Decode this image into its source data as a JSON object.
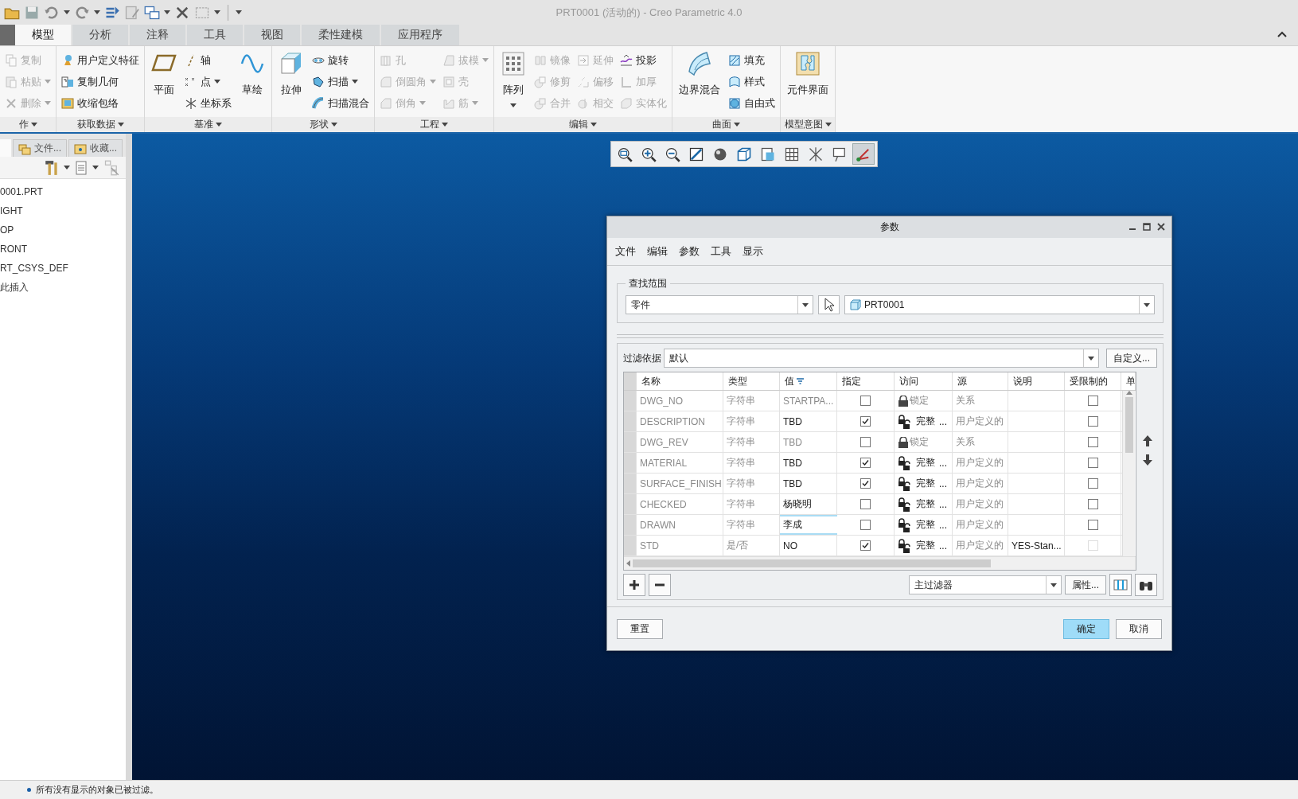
{
  "window": {
    "title": "PRT0001 (活动的) - Creo Parametric 4.0"
  },
  "ribbon": {
    "tabs": [
      {
        "label": "模型",
        "selected": true
      },
      {
        "label": "分析",
        "selected": false
      },
      {
        "label": "注释",
        "selected": false
      },
      {
        "label": "工具",
        "selected": false
      },
      {
        "label": "视图",
        "selected": false
      },
      {
        "label": "柔性建模",
        "selected": false
      },
      {
        "label": "应用程序",
        "selected": false
      }
    ],
    "groups": [
      {
        "label": "作",
        "columns": [
          [
            {
              "label": "复制",
              "kind": "small",
              "disabled": true,
              "dropdown": false
            },
            {
              "label": "粘贴",
              "kind": "small",
              "disabled": true,
              "dropdown": true
            },
            {
              "label": "删除",
              "kind": "small",
              "disabled": true,
              "dropdown": true
            }
          ]
        ]
      },
      {
        "label": "获取数据",
        "columns": [
          [
            {
              "label": "用户定义特征",
              "kind": "small",
              "disabled": false,
              "dropdown": false
            },
            {
              "label": "复制几何",
              "kind": "small",
              "disabled": false,
              "dropdown": false
            },
            {
              "label": "收缩包络",
              "kind": "small",
              "disabled": false,
              "dropdown": false
            }
          ]
        ]
      },
      {
        "label": "基准",
        "columns": [
          [
            {
              "label": "平面",
              "kind": "large",
              "disabled": false,
              "dropdown": false
            }
          ],
          [
            {
              "label": "轴",
              "kind": "small",
              "disabled": false,
              "dropdown": false
            },
            {
              "label": "点",
              "kind": "small",
              "disabled": false,
              "dropdown": true
            },
            {
              "label": "坐标系",
              "kind": "small",
              "disabled": false,
              "dropdown": false
            }
          ],
          [
            {
              "label": "草绘",
              "kind": "large",
              "disabled": false,
              "dropdown": false
            }
          ]
        ]
      },
      {
        "label": "形状",
        "columns": [
          [
            {
              "label": "拉伸",
              "kind": "large",
              "disabled": false,
              "dropdown": false
            }
          ],
          [
            {
              "label": "旋转",
              "kind": "small",
              "disabled": false,
              "dropdown": false
            },
            {
              "label": "扫描",
              "kind": "small",
              "disabled": false,
              "dropdown": true
            },
            {
              "label": "扫描混合",
              "kind": "small",
              "disabled": false,
              "dropdown": false
            }
          ]
        ]
      },
      {
        "label": "工程",
        "columns": [
          [
            {
              "label": "孔",
              "kind": "small",
              "disabled": true,
              "dropdown": false
            },
            {
              "label": "倒圆角",
              "kind": "small",
              "disabled": true,
              "dropdown": true
            },
            {
              "label": "倒角",
              "kind": "small",
              "disabled": true,
              "dropdown": true
            }
          ],
          [
            {
              "label": "拔模",
              "kind": "small",
              "disabled": true,
              "dropdown": true
            },
            {
              "label": "壳",
              "kind": "small",
              "disabled": true,
              "dropdown": false
            },
            {
              "label": "筋",
              "kind": "small",
              "disabled": true,
              "dropdown": true
            }
          ]
        ]
      },
      {
        "label": "编辑",
        "columns": [
          [
            {
              "label": "阵列",
              "kind": "large",
              "disabled": false,
              "dropdown": true
            }
          ],
          [
            {
              "label": "镜像",
              "kind": "small",
              "disabled": true,
              "dropdown": false
            },
            {
              "label": "修剪",
              "kind": "small",
              "disabled": true,
              "dropdown": false
            },
            {
              "label": "合并",
              "kind": "small",
              "disabled": true,
              "dropdown": false
            }
          ],
          [
            {
              "label": "延伸",
              "kind": "small",
              "disabled": true,
              "dropdown": false
            },
            {
              "label": "偏移",
              "kind": "small",
              "disabled": true,
              "dropdown": false
            },
            {
              "label": "相交",
              "kind": "small",
              "disabled": true,
              "dropdown": false
            }
          ],
          [
            {
              "label": "投影",
              "kind": "small",
              "disabled": false,
              "dropdown": false
            },
            {
              "label": "加厚",
              "kind": "small",
              "disabled": true,
              "dropdown": false
            },
            {
              "label": "实体化",
              "kind": "small",
              "disabled": true,
              "dropdown": false
            }
          ]
        ]
      },
      {
        "label": "曲面",
        "columns": [
          [
            {
              "label": "边界混合",
              "kind": "large",
              "disabled": false,
              "dropdown": false
            }
          ],
          [
            {
              "label": "填充",
              "kind": "small",
              "disabled": false,
              "dropdown": false
            },
            {
              "label": "样式",
              "kind": "small",
              "disabled": false,
              "dropdown": false
            },
            {
              "label": "自由式",
              "kind": "small",
              "disabled": false,
              "dropdown": false
            }
          ]
        ]
      },
      {
        "label": "模型意图",
        "columns": [
          [
            {
              "label": "元件界面",
              "kind": "large",
              "disabled": false,
              "dropdown": false
            }
          ]
        ]
      }
    ]
  },
  "model_tree": {
    "tabs": [
      {
        "label": "文件...",
        "selected": false
      },
      {
        "label": "收藏...",
        "selected": false
      }
    ],
    "items": [
      "0001.PRT",
      "IGHT",
      "OP",
      "RONT",
      "RT_CSYS_DEF",
      "此插入"
    ]
  },
  "view_toolbar": [
    {
      "selected": false
    },
    {
      "selected": false
    },
    {
      "selected": false
    },
    {
      "selected": false
    },
    {
      "selected": false
    },
    {
      "selected": false
    },
    {
      "selected": false
    },
    {
      "selected": false
    },
    {
      "selected": false
    },
    {
      "selected": false
    },
    {
      "selected": true
    }
  ],
  "dialog": {
    "title": "参数",
    "menu": [
      "文件",
      "编辑",
      "参数",
      "工具",
      "显示"
    ],
    "scope": {
      "legend": "查找范围",
      "type": "零件",
      "object": "PRT0001"
    },
    "filter": {
      "label": "过滤依据",
      "value": "默认",
      "button": "自定义..."
    },
    "table": {
      "columns": [
        {
          "label": "名称",
          "sorted": false
        },
        {
          "label": "类型",
          "sorted": false
        },
        {
          "label": "值",
          "sorted": true
        },
        {
          "label": "指定",
          "sorted": false
        },
        {
          "label": "访问",
          "sorted": false
        },
        {
          "label": "源",
          "sorted": false
        },
        {
          "label": "说明",
          "sorted": false
        },
        {
          "label": "受限制的",
          "sorted": false
        },
        {
          "label": "单"
        }
      ],
      "rows": [
        {
          "name": "DWG_NO",
          "type": "字符串",
          "value": "STARTPA...",
          "locked": true,
          "editing": false,
          "designated": false,
          "access": "锁定",
          "source": "关系",
          "restricted": false,
          "restricted_disabled": false
        },
        {
          "name": "DESCRIPTION",
          "type": "字符串",
          "value": "TBD",
          "locked": false,
          "editing": false,
          "designated": true,
          "access": "完整",
          "access_more": "...",
          "source": "用户定义的",
          "restricted": false,
          "restricted_disabled": false
        },
        {
          "name": "DWG_REV",
          "type": "字符串",
          "value": "TBD",
          "locked": true,
          "editing": false,
          "designated": false,
          "access": "锁定",
          "source": "关系",
          "restricted": false,
          "restricted_disabled": false
        },
        {
          "name": "MATERIAL",
          "type": "字符串",
          "value": "TBD",
          "locked": false,
          "editing": false,
          "designated": true,
          "access": "完整",
          "access_more": "...",
          "source": "用户定义的",
          "restricted": false,
          "restricted_disabled": false
        },
        {
          "name": "SURFACE_FINISH",
          "type": "字符串",
          "value": "TBD",
          "locked": false,
          "editing": false,
          "designated": true,
          "access": "完整",
          "access_more": "...",
          "source": "用户定义的",
          "restricted": false,
          "restricted_disabled": false
        },
        {
          "name": "CHECKED",
          "type": "字符串",
          "value": "杨晓明",
          "locked": false,
          "editing": false,
          "designated": false,
          "access": "完整",
          "access_more": "...",
          "source": "用户定义的",
          "restricted": false,
          "restricted_disabled": false
        },
        {
          "name": "DRAWN",
          "type": "字符串",
          "value": "李成",
          "locked": false,
          "editing": true,
          "designated": false,
          "access": "完整",
          "access_more": "...",
          "source": "用户定义的",
          "restricted": false,
          "restricted_disabled": false
        },
        {
          "name": "STD",
          "type": "是/否",
          "value": "NO",
          "locked": false,
          "editing": false,
          "designated": true,
          "access": "完整",
          "access_more": "...",
          "source": "用户定义的",
          "description": "YES-Stan...",
          "restricted": false,
          "restricted_disabled": true
        }
      ]
    },
    "main_filter": "主过滤器",
    "properties_button": "属性...",
    "buttons": [
      {
        "label": "重置",
        "primary": false
      },
      {
        "label": "确定",
        "primary": true
      },
      {
        "label": "取消",
        "primary": false
      }
    ]
  },
  "status_bar": {
    "message": "所有没有显示的对象已被过滤。"
  }
}
